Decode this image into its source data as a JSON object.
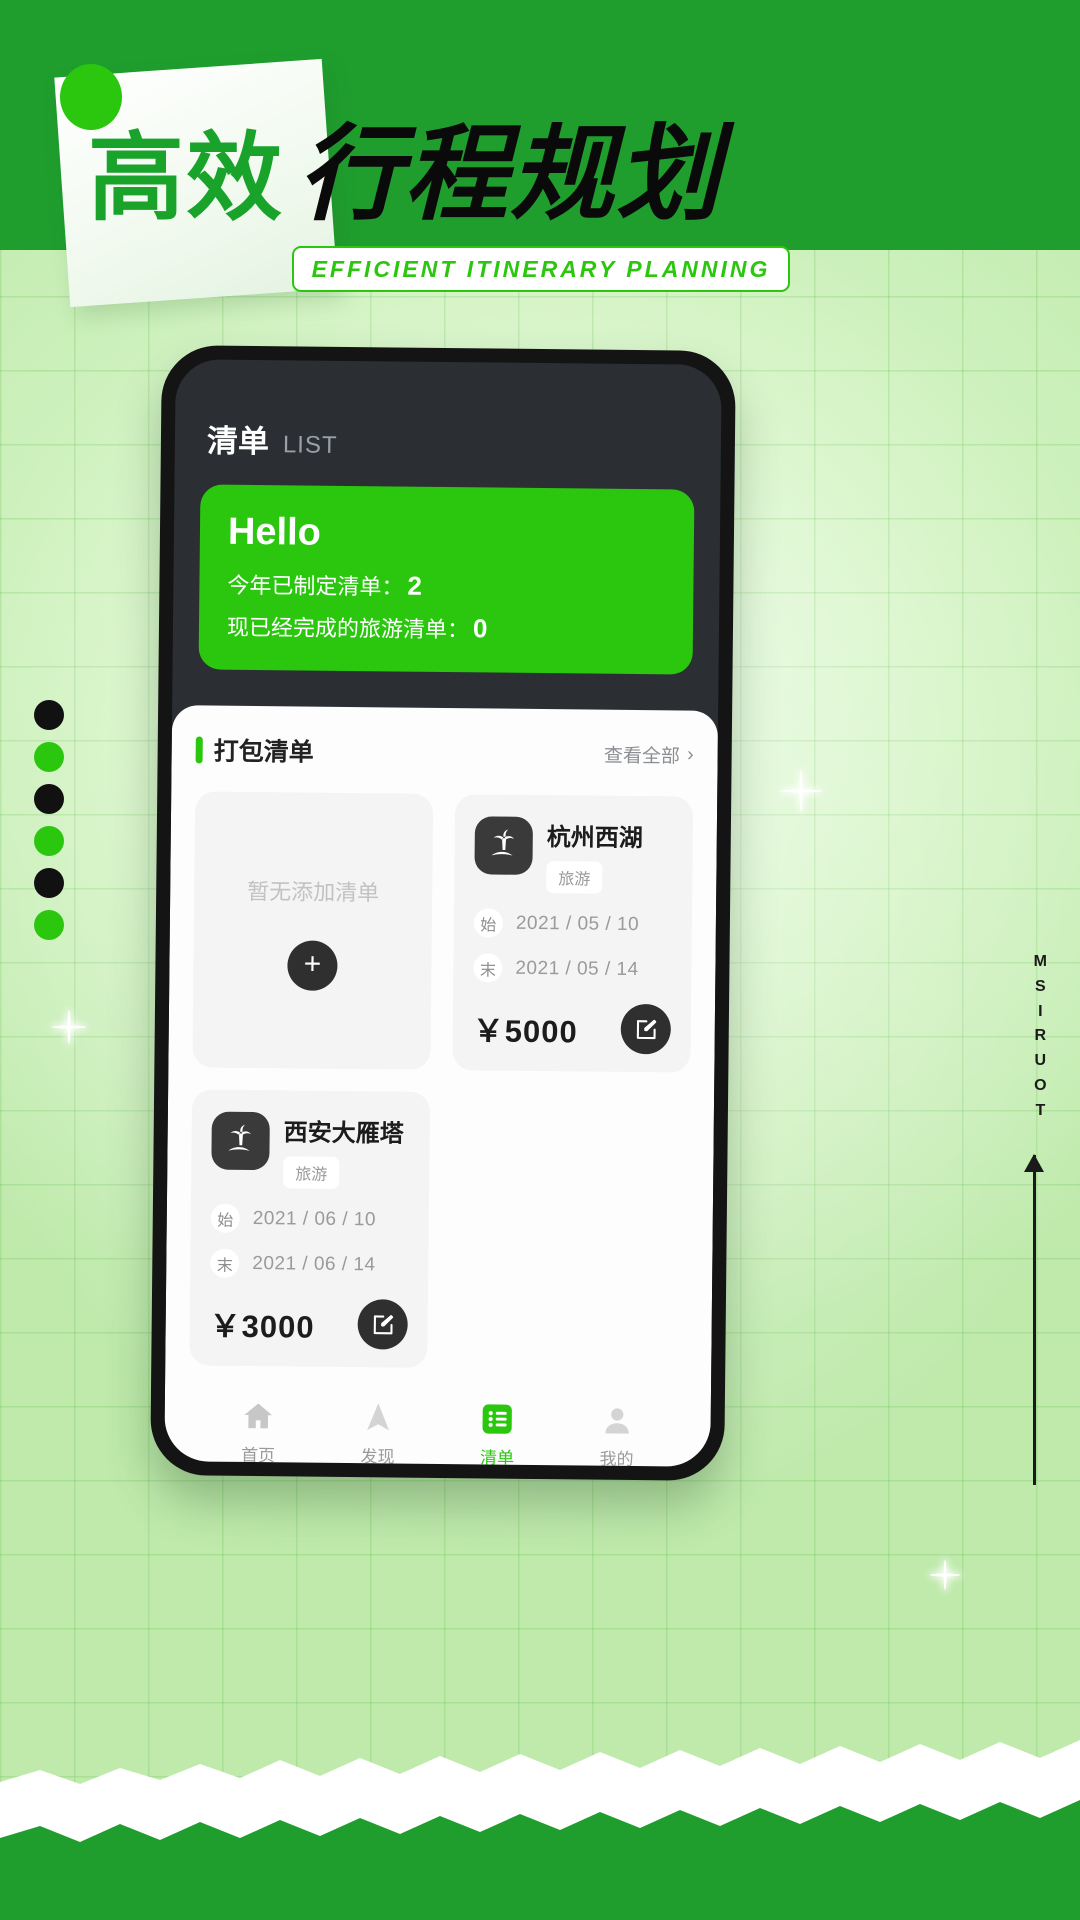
{
  "poster": {
    "title_green": "高效",
    "title_black": "行程规划",
    "english_banner": "EFFICIENT  ITINERARY  PLANNING",
    "vertical_label": "TOURISM",
    "accent_green": "#2bc70f",
    "deep_green": "#1f9e2e",
    "dots": [
      "dark",
      "green",
      "dark",
      "green",
      "dark",
      "green"
    ]
  },
  "app": {
    "header": {
      "title": "清单",
      "subtitle": "LIST"
    },
    "hello_card": {
      "greeting": "Hello",
      "stat1_label": "今年已制定清单：",
      "stat1_value": "2",
      "stat2_label": "现已经完成的旅游清单：",
      "stat2_value": "0"
    },
    "section": {
      "title": "打包清单",
      "see_all": "查看全部",
      "chevron": "›"
    },
    "empty_card": {
      "text": "暂无添加清单",
      "add_label": "+"
    },
    "trips": [
      {
        "name": "杭州西湖",
        "tag": "旅游",
        "start_label": "始",
        "start_date": "2021 / 05 / 10",
        "end_label": "末",
        "end_date": "2021 / 05 / 14",
        "price": "￥5000"
      },
      {
        "name": "西安大雁塔",
        "tag": "旅游",
        "start_label": "始",
        "start_date": "2021 / 06 / 10",
        "end_label": "末",
        "end_date": "2021 / 06 / 14",
        "price": "￥3000"
      }
    ],
    "tabs": [
      {
        "label": "首页",
        "icon": "home-icon",
        "active": false
      },
      {
        "label": "发现",
        "icon": "navigation-icon",
        "active": false
      },
      {
        "label": "清单",
        "icon": "list-icon",
        "active": true
      },
      {
        "label": "我的",
        "icon": "person-icon",
        "active": false
      }
    ]
  }
}
